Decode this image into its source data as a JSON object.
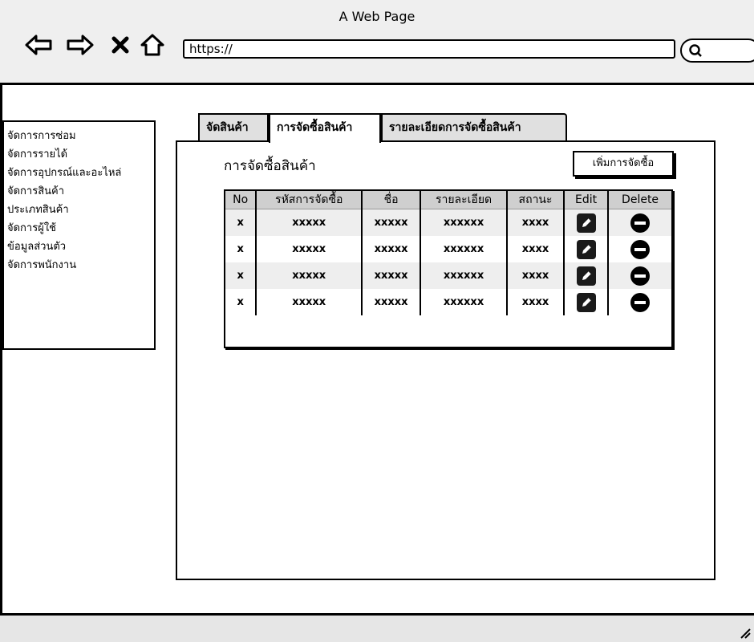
{
  "window": {
    "title": "A Web Page"
  },
  "browser": {
    "url": "https://",
    "icons": [
      "back-arrow-icon",
      "forward-arrow-icon",
      "close-x-icon",
      "home-icon",
      "search-icon"
    ]
  },
  "sidebar": {
    "items": [
      {
        "label": "จัดการการซ่อม"
      },
      {
        "label": "จัดการรายได้"
      },
      {
        "label": "จัดการอุปกรณ์และอะไหล่"
      },
      {
        "label": "จัดการสินค้า"
      },
      {
        "label": "ประเภทสินค้า"
      },
      {
        "label": "จัดการผู้ใช้"
      },
      {
        "label": "ข้อมูลส่วนตัว"
      },
      {
        "label": "จัดการพนักงาน"
      }
    ]
  },
  "tabs": [
    {
      "label": "จัดสินค้า",
      "active": false
    },
    {
      "label": "การจัดซื้อสินค้า",
      "active": true
    },
    {
      "label": "รายละเอียดการจัดซื้อสินค้า",
      "active": false
    }
  ],
  "main": {
    "title": "การจัดซื้อสินค้า",
    "add_button": "เพิ่มการจัดซื้อ",
    "table": {
      "headers": [
        "No",
        "รหัสการจัดซื้อ",
        "ชื่อ",
        "รายละเอียด",
        "สถานะ",
        "Edit",
        "Delete"
      ],
      "rows": [
        [
          "x",
          "xxxxx",
          "xxxxx",
          "xxxxxx",
          "xxxx"
        ],
        [
          "x",
          "xxxxx",
          "xxxxx",
          "xxxxxx",
          "xxxx"
        ],
        [
          "x",
          "xxxxx",
          "xxxxx",
          "xxxxxx",
          "xxxx"
        ],
        [
          "x",
          "xxxxx",
          "xxxxx",
          "xxxxxx",
          "xxxx"
        ]
      ]
    }
  },
  "colors": {
    "header_bg": "#cfcfcf",
    "browser_bg": "#efefef",
    "stripe": "#eeeeee"
  }
}
